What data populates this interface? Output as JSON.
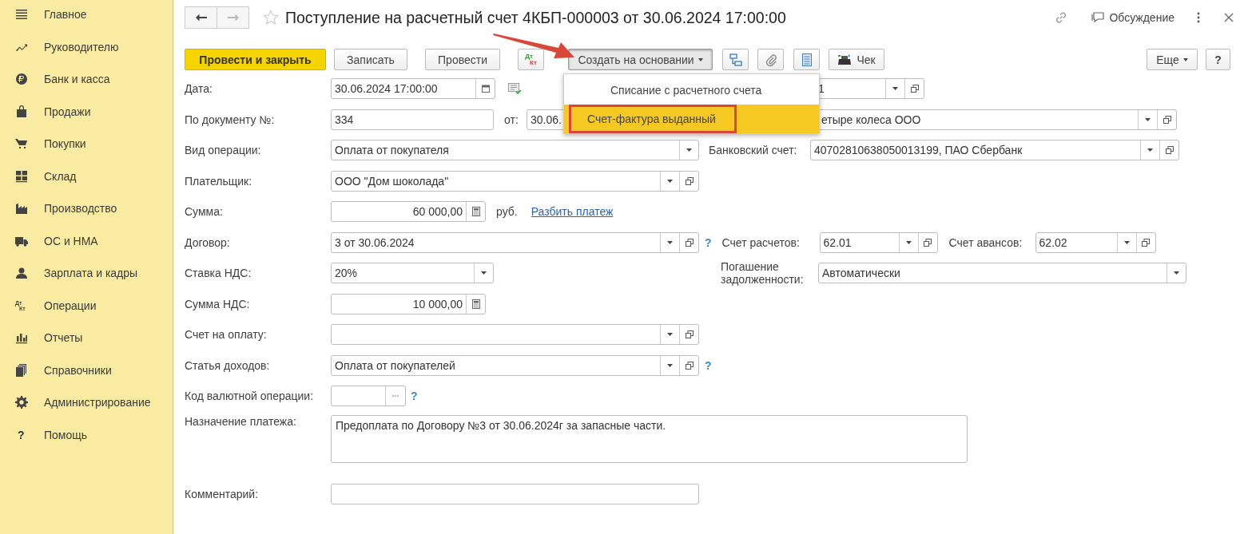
{
  "sidebar": {
    "items": [
      {
        "label": "Главное"
      },
      {
        "label": "Руководителю"
      },
      {
        "label": "Банк и касса"
      },
      {
        "label": "Продажи"
      },
      {
        "label": "Покупки"
      },
      {
        "label": "Склад"
      },
      {
        "label": "Производство"
      },
      {
        "label": "ОС и НМА"
      },
      {
        "label": "Зарплата и кадры"
      },
      {
        "label": "Операции",
        "icon_text": [
          "Дт",
          "Кт"
        ]
      },
      {
        "label": "Отчеты"
      },
      {
        "label": "Справочники"
      },
      {
        "label": "Администрирование"
      },
      {
        "label": "Помощь",
        "icon_text": [
          "?"
        ]
      }
    ]
  },
  "header": {
    "title": "Поступление на расчетный счет 4КБП-000003 от 30.06.2024 17:00:00",
    "favorite": false,
    "discussion": "Обсуждение"
  },
  "toolbar": {
    "post_close": "Провести и закрыть",
    "save": "Записать",
    "post": "Провести",
    "dt_kt": [
      "Дт",
      "Кт"
    ],
    "create_based": {
      "label": "Создать на основании",
      "expanded": true
    },
    "receipt": "Чек",
    "more": "Еще",
    "help": "?"
  },
  "create_menu": {
    "items": [
      {
        "label": "Списание с расчетного счета",
        "selected": false,
        "outlined": false
      },
      {
        "label": "Счет-фактура выданный",
        "selected": true,
        "outlined": true
      }
    ]
  },
  "form": {
    "date": {
      "label": "Дата:",
      "value": "30.06.2024 17:00:00"
    },
    "org": {
      "value": "1"
    },
    "doc_number": {
      "label": "По документу №:",
      "value": "334"
    },
    "doc_date": {
      "label": "от:",
      "value": "30.06."
    },
    "counterparty": {
      "value": "етыре колеса ООО"
    },
    "operation": {
      "label": "Вид операции:",
      "value": "Оплата от покупателя"
    },
    "bank_account": {
      "label": "Банковский счет:",
      "value": "40702810638050013199, ПАО Сбербанк"
    },
    "payer": {
      "label": "Плательщик:",
      "value": "ООО \"Дом шоколада\""
    },
    "amount": {
      "label": "Сумма:",
      "value": "60 000,00",
      "currency": "руб.",
      "split_link": "Разбить платеж"
    },
    "contract": {
      "label": "Договор:",
      "value": "3 от 30.06.2024",
      "help": "?"
    },
    "settlement_account": {
      "label": "Счет расчетов:",
      "value": "62.01"
    },
    "advance_account": {
      "label": "Счет авансов:",
      "value": "62.02"
    },
    "vat_rate": {
      "label": "Ставка НДС:",
      "value": "20%"
    },
    "debt_repayment": {
      "label": "Погашение задолженности:",
      "value": "Автоматически"
    },
    "vat_amount": {
      "label": "Сумма НДС:",
      "value": "10 000,00"
    },
    "invoice": {
      "label": "Счет на оплату:"
    },
    "income_item": {
      "label": "Статья доходов:",
      "value": "Оплата от покупателей",
      "help": "?"
    },
    "currency_code": {
      "label": "Код валютной операции:",
      "help": "?"
    },
    "purpose": {
      "label": "Назначение платежа:",
      "value": "Предоплата по Договору №3 от 30.06.2024г за запасные части."
    },
    "comment": {
      "label": "Комментарий:"
    }
  }
}
